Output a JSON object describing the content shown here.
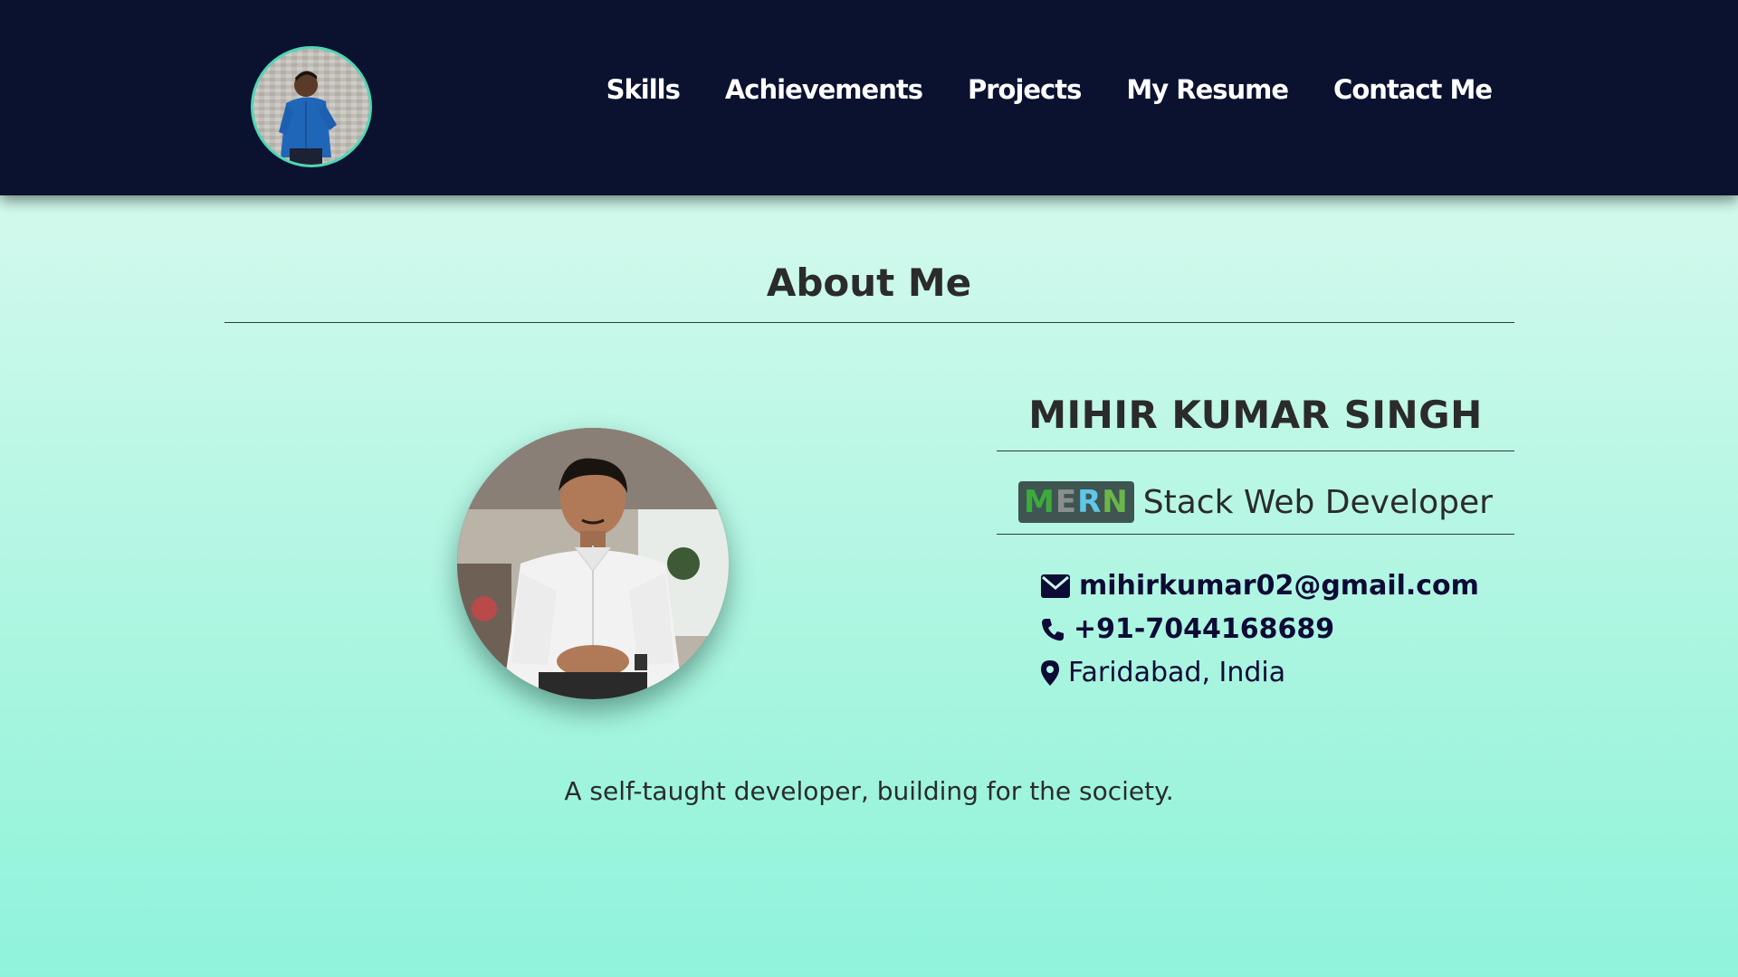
{
  "nav": {
    "items": [
      {
        "label": "Skills"
      },
      {
        "label": "Achievements"
      },
      {
        "label": "Projects"
      },
      {
        "label": "My Resume"
      },
      {
        "label": "Contact Me"
      }
    ]
  },
  "about": {
    "title": "About Me",
    "name": "MIHIR KUMAR SINGH",
    "badge": {
      "letters": [
        {
          "char": "M",
          "color": "#3cab3c"
        },
        {
          "char": "E",
          "color": "#8a8f8e"
        },
        {
          "char": "R",
          "color": "#60c7e6"
        },
        {
          "char": "N",
          "color": "#6bb64a"
        }
      ]
    },
    "role": "Stack Web Developer",
    "email": "mihirkumar02@gmail.com",
    "phone": "+91-7044168689",
    "location": "Faridabad, India",
    "tagline": "A self-taught developer, building for the society."
  },
  "icons": {
    "email": "envelope-icon",
    "phone": "phone-icon",
    "location": "map-marker-icon"
  },
  "colors": {
    "header_bg": "#0b1230",
    "accent": "#4fd6b4",
    "contact_text": "#0d0a36"
  }
}
